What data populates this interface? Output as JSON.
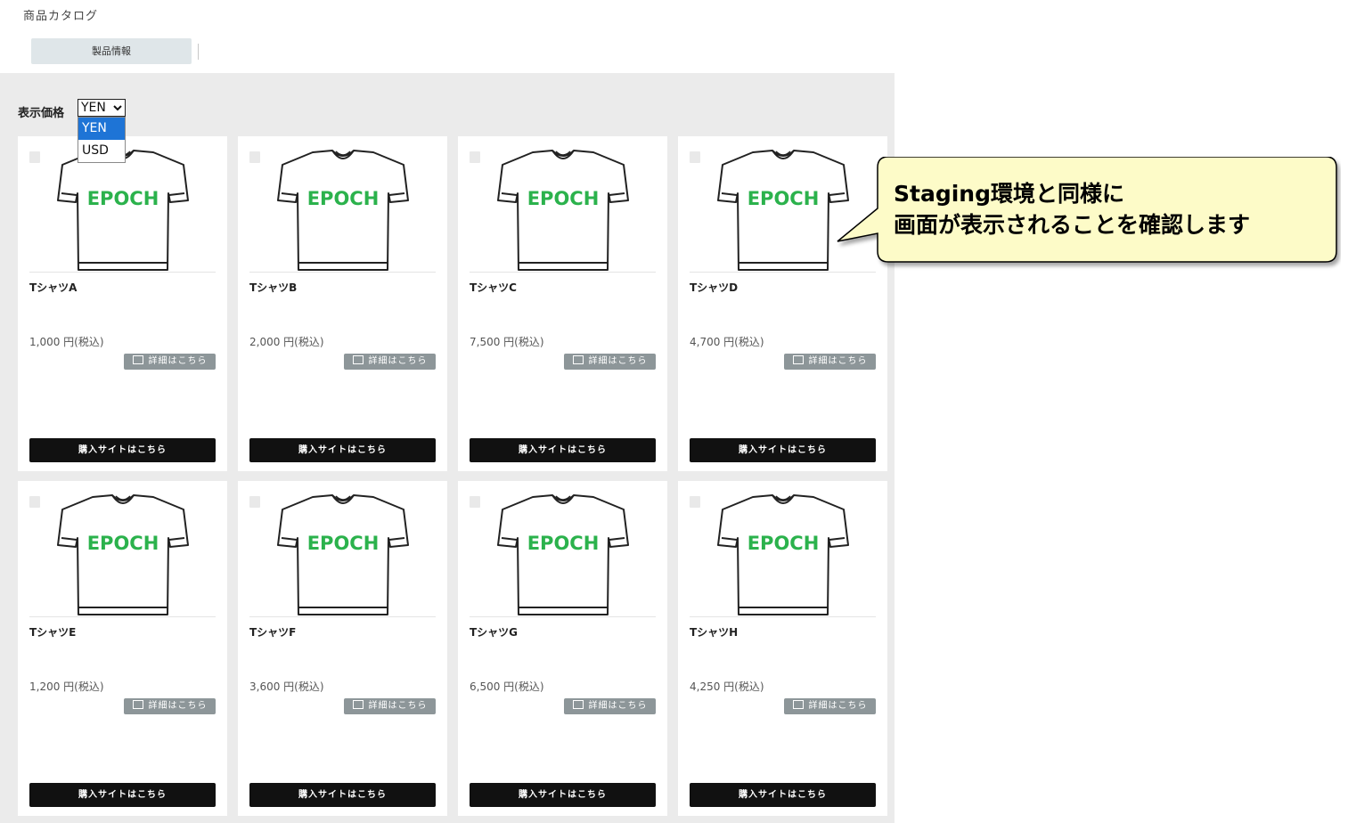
{
  "page": {
    "title": "商品カタログ"
  },
  "tabs": [
    {
      "label": "製品情報"
    }
  ],
  "currency": {
    "label": "表示価格",
    "selected": "YEN",
    "options": [
      "YEN",
      "USD"
    ]
  },
  "products": [
    {
      "name": "TシャツA",
      "price": "1,000 円(税込)",
      "logo_text": "EPOCH",
      "detail_label": "詳細はこちら",
      "buy_label": "購入サイトはこちら"
    },
    {
      "name": "TシャツB",
      "price": "2,000 円(税込)",
      "logo_text": "EPOCH",
      "detail_label": "詳細はこちら",
      "buy_label": "購入サイトはこちら"
    },
    {
      "name": "TシャツC",
      "price": "7,500 円(税込)",
      "logo_text": "EPOCH",
      "detail_label": "詳細はこちら",
      "buy_label": "購入サイトはこちら"
    },
    {
      "name": "TシャツD",
      "price": "4,700 円(税込)",
      "logo_text": "EPOCH",
      "detail_label": "詳細はこちら",
      "buy_label": "購入サイトはこちら"
    },
    {
      "name": "TシャツE",
      "price": "1,200 円(税込)",
      "logo_text": "EPOCH",
      "detail_label": "詳細はこちら",
      "buy_label": "購入サイトはこちら"
    },
    {
      "name": "TシャツF",
      "price": "3,600 円(税込)",
      "logo_text": "EPOCH",
      "detail_label": "詳細はこちら",
      "buy_label": "購入サイトはこちら"
    },
    {
      "name": "TシャツG",
      "price": "6,500 円(税込)",
      "logo_text": "EPOCH",
      "detail_label": "詳細はこちら",
      "buy_label": "購入サイトはこちら"
    },
    {
      "name": "TシャツH",
      "price": "4,250 円(税込)",
      "logo_text": "EPOCH",
      "detail_label": "詳細はこちら",
      "buy_label": "購入サイトはこちら"
    }
  ],
  "callout": {
    "line1": "Staging環境と同様に",
    "line2": "画面が表示されることを確認します"
  },
  "colors": {
    "logo_green": "#2bb24c",
    "callout_fill": "#fdfbc8",
    "select_highlight": "#1e74d6",
    "buy_button": "#111111",
    "detail_button": "#8d9699"
  },
  "icons": {
    "select_caret": "chevron-down-icon",
    "detail_button": "window-icon"
  }
}
